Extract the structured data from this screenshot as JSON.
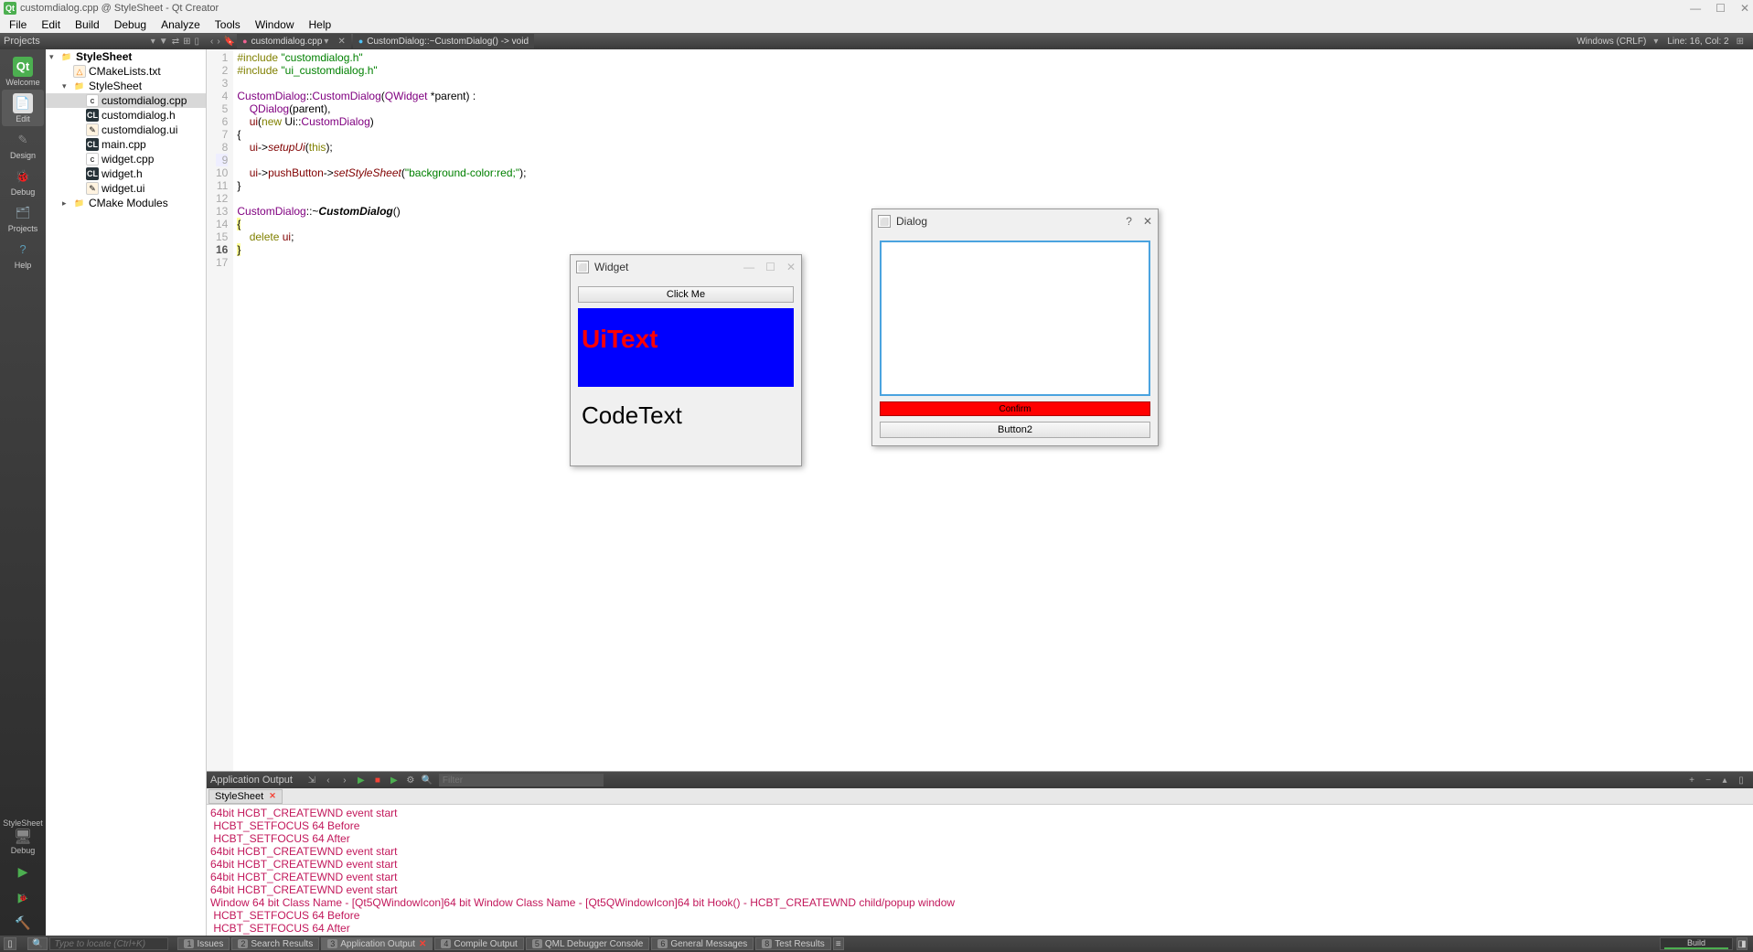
{
  "title_bar": {
    "app_icon": "Qt",
    "title": "customdialog.cpp @ StyleSheet - Qt Creator"
  },
  "menu": {
    "file": "File",
    "edit": "Edit",
    "build": "Build",
    "debug": "Debug",
    "analyze": "Analyze",
    "tools": "Tools",
    "window": "Window",
    "help": "Help"
  },
  "toolbar": {
    "projects_label": "Projects",
    "back": "‹",
    "fwd": "›",
    "open_file_tab": "customdialog.cpp",
    "symbol_tab": "CustomDialog::~CustomDialog() -> void",
    "encoding": "Windows (CRLF)",
    "line_col": "Line: 16, Col: 2"
  },
  "modes": {
    "welcome": "Welcome",
    "edit": "Edit",
    "design": "Design",
    "debug": "Debug",
    "projects": "Projects",
    "help": "Help",
    "target_kit": "StyleSheet",
    "target_config": "Debug"
  },
  "tree": {
    "root": "StyleSheet",
    "items": [
      "CMakeLists.txt",
      "StyleSheet",
      "customdialog.cpp",
      "customdialog.h",
      "customdialog.ui",
      "main.cpp",
      "widget.cpp",
      "widget.h",
      "widget.ui",
      "CMake Modules"
    ]
  },
  "code": {
    "l1a": "#include",
    "l1b": " \"customdialog.h\"",
    "l2a": "#include",
    "l2b": " \"ui_customdialog.h\"",
    "l4a": "CustomDialog",
    "l4b": "::",
    "l4c": "CustomDialog",
    "l4d": "(",
    "l4e": "QWidget",
    "l4f": " *parent) :",
    "l5a": "    ",
    "l5b": "QDialog",
    "l5c": "(parent),",
    "l6a": "    ",
    "l6b": "ui",
    "l6c": "(",
    "l6d": "new",
    "l6e": " Ui::",
    "l6f": "CustomDialog",
    "l6g": ")",
    "l7": "{",
    "l8a": "    ",
    "l8b": "ui",
    "l8c": "->",
    "l8d": "setupUi",
    "l8e": "(",
    "l8f": "this",
    "l8g": ");",
    "l10a": "    ",
    "l10b": "ui",
    "l10c": "->",
    "l10d": "pushButton",
    "l10e": "->",
    "l10f": "setStyleSheet",
    "l10g": "(",
    "l10h": "\"background-color:red;\"",
    "l10i": ");",
    "l11": "}",
    "l13a": "CustomDialog",
    "l13b": "::~",
    "l13c": "CustomDialog",
    "l13d": "()",
    "l14": "{",
    "l15a": "    ",
    "l15b": "delete",
    "l15c": " ",
    "l15d": "ui",
    "l15e": ";",
    "l16": "}",
    "line_numbers": [
      "1",
      "2",
      "3",
      "4",
      "5",
      "6",
      "7",
      "8",
      "9",
      "10",
      "11",
      "12",
      "13",
      "14",
      "15",
      "16",
      "17"
    ]
  },
  "output": {
    "panel_title": "Application Output",
    "tab": "StyleSheet",
    "filter_placeholder": "Filter",
    "lines": [
      "64bit HCBT_CREATEWND event start",
      " HCBT_SETFOCUS 64 Before",
      " HCBT_SETFOCUS 64 After",
      "64bit HCBT_CREATEWND event start",
      "64bit HCBT_CREATEWND event start",
      "64bit HCBT_CREATEWND event start",
      "64bit HCBT_CREATEWND event start",
      "Window 64 bit Class Name - [Qt5QWindowIcon]64 bit Window Class Name - [Qt5QWindowIcon]64 bit Hook() - HCBT_CREATEWND child/popup window",
      " HCBT_SETFOCUS 64 Before",
      " HCBT_SETFOCUS 64 After"
    ]
  },
  "status": {
    "locator_placeholder": "Type to locate (Ctrl+K)",
    "tabs": {
      "1": "Issues",
      "2": "Search Results",
      "3": "Application Output",
      "4": "Compile Output",
      "5": "QML Debugger Console",
      "6": "General Messages",
      "8": "Test Results"
    },
    "build_label": "Build"
  },
  "widget_window": {
    "title": "Widget",
    "click_me": "Click Me",
    "ui_text": "UiText",
    "code_text": "CodeText"
  },
  "dialog_window": {
    "title": "Dialog",
    "confirm": "Confirm",
    "button2": "Button2"
  }
}
